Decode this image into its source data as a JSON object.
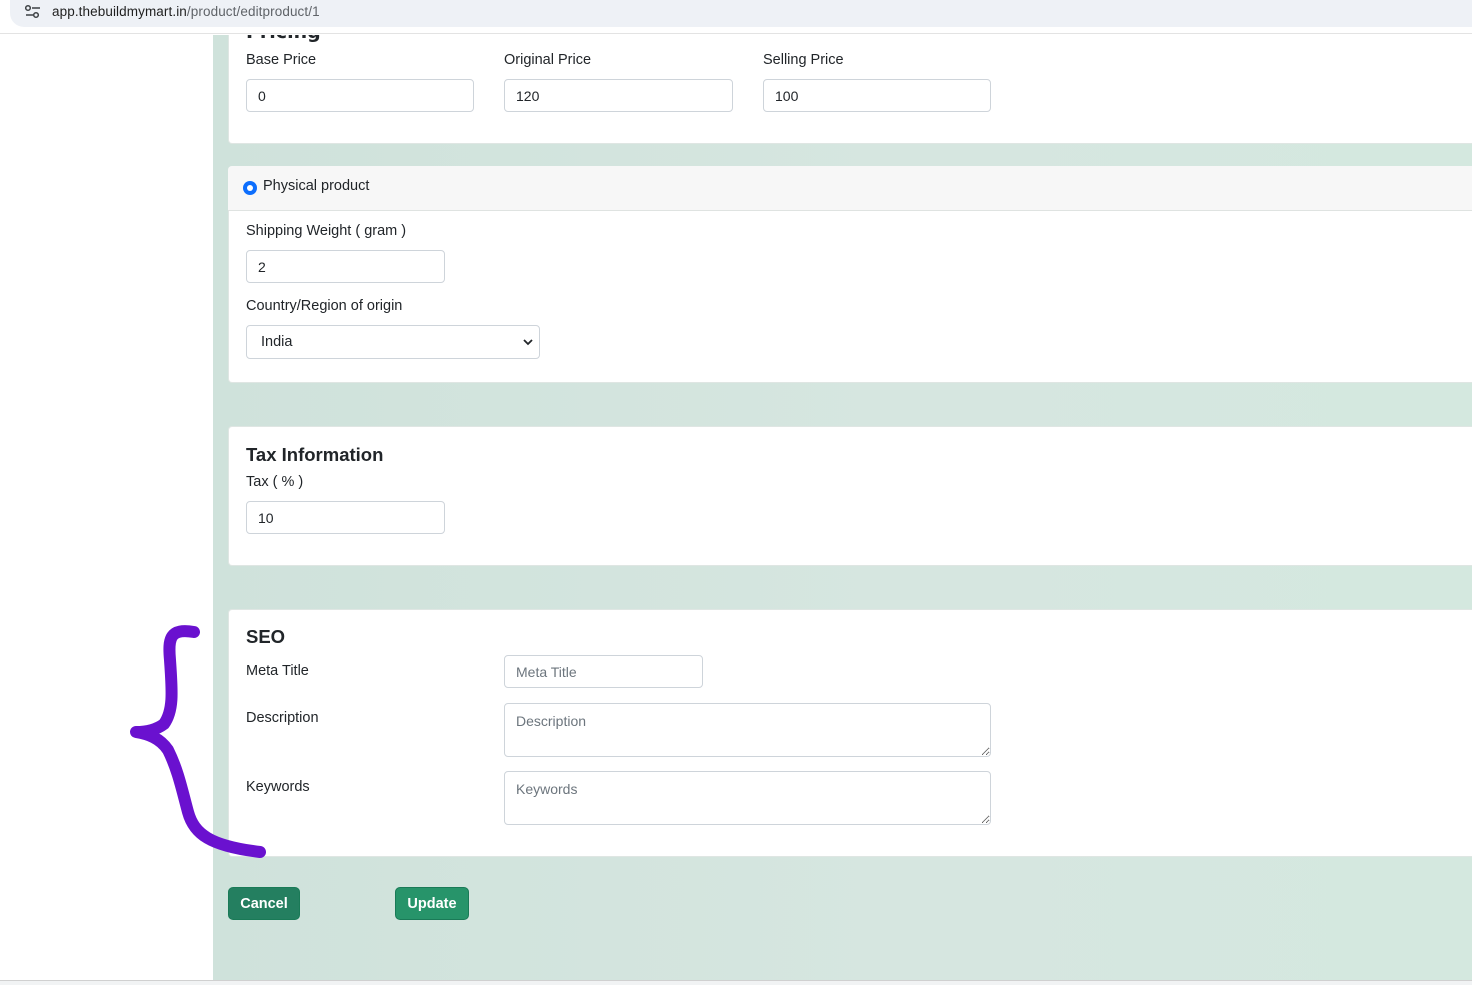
{
  "browser": {
    "url_domain": "app.thebuildmymart.in",
    "url_path": "/product/editproduct/1"
  },
  "pricing": {
    "title": "Pricing",
    "base_price_label": "Base Price",
    "base_price_value": "0",
    "original_price_label": "Original Price",
    "original_price_value": "120",
    "selling_price_label": "Selling Price",
    "selling_price_value": "100"
  },
  "physical": {
    "radio_label": "Physical product",
    "weight_label": "Shipping Weight ( gram )",
    "weight_value": "2",
    "origin_label": "Country/Region of origin",
    "origin_value": "India"
  },
  "tax": {
    "title": "Tax Information",
    "tax_label": "Tax ( % )",
    "tax_value": "10"
  },
  "seo": {
    "title": "SEO",
    "meta_title_label": "Meta Title",
    "meta_title_placeholder": "Meta Title",
    "description_label": "Description",
    "description_placeholder": "Description",
    "keywords_label": "Keywords",
    "keywords_placeholder": "Keywords"
  },
  "actions": {
    "cancel_label": "Cancel",
    "update_label": "Update"
  },
  "colors": {
    "accent_green": "#1f8a63",
    "radio_blue": "#0d6efd",
    "annotation_purple": "#6a11cf"
  }
}
